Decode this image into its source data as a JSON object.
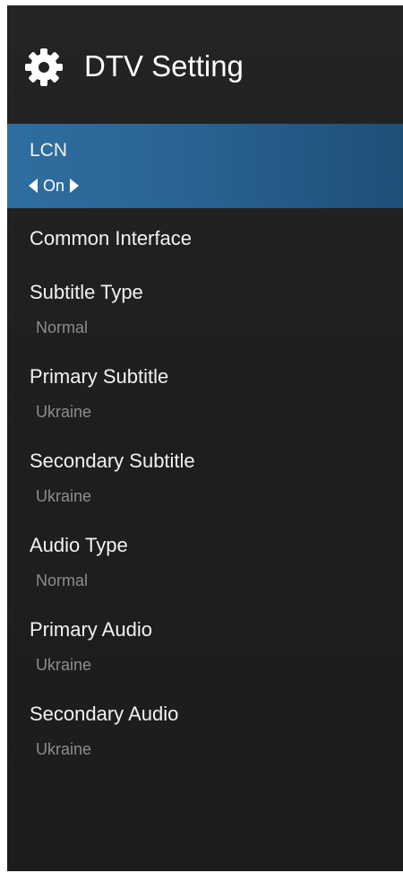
{
  "header": {
    "title": "DTV Setting",
    "icon": "gear-icon"
  },
  "menu": {
    "items": [
      {
        "label": "LCN",
        "value": "On",
        "selected": true
      },
      {
        "label": "Common Interface"
      },
      {
        "label": "Subtitle Type",
        "value": "Normal"
      },
      {
        "label": "Primary Subtitle",
        "value": "Ukraine"
      },
      {
        "label": "Secondary Subtitle",
        "value": "Ukraine"
      },
      {
        "label": "Audio Type",
        "value": "Normal"
      },
      {
        "label": "Primary Audio",
        "value": "Ukraine"
      },
      {
        "label": "Secondary Audio",
        "value": "Ukraine"
      }
    ]
  },
  "colors": {
    "highlight": "#2a6393",
    "background": "#1f1f1f",
    "text": "#f2f2f2",
    "secondary_text": "#8d8d8d"
  }
}
